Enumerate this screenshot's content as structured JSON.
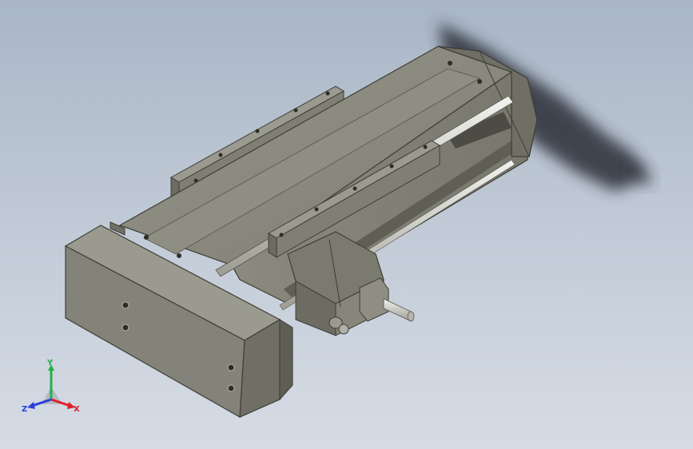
{
  "viewport": {
    "background_top": "#a9b6c6",
    "background_bottom": "#d6dce5"
  },
  "model": {
    "body_color": "#86867a",
    "dark_edge_color": "#3e3e36",
    "rod_color": "#d8d8d2"
  },
  "triad": {
    "x_label": "X",
    "y_label": "Y",
    "z_label": "Z",
    "x_color": "#e0202a",
    "y_color": "#22b24a",
    "z_color": "#2a3ed8"
  }
}
